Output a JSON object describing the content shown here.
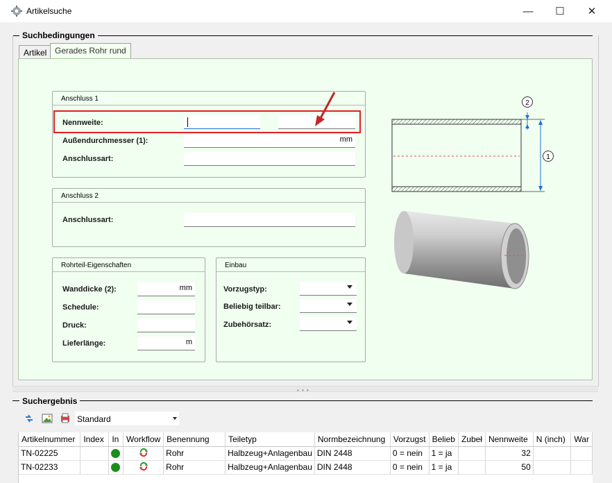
{
  "window": {
    "title": "Artikelsuche",
    "minimize": "—",
    "maximize": "☐",
    "close": "✕"
  },
  "search": {
    "group_title": "Suchbedingungen",
    "tabs": [
      {
        "label": "Artikel"
      },
      {
        "label": "Gerades Rohr rund"
      }
    ],
    "anschluss1": {
      "title": "Anschluss 1",
      "nennweite_label": "Nennweite:",
      "nennweite_value": "",
      "nennweite_value2": "",
      "aussen_label": "Außendurchmesser (1):",
      "aussen_unit": "mm",
      "anschlussart_label": "Anschlussart:",
      "anschlussart_value": ""
    },
    "anschluss2": {
      "title": "Anschluss 2",
      "anschlussart_label": "Anschlussart:",
      "anschlussart_value": ""
    },
    "rohrteil": {
      "title": "Rohrteil-Eigenschaften",
      "wanddicke_label": "Wanddicke (2):",
      "wanddicke_unit": "mm",
      "schedule_label": "Schedule:",
      "druck_label": "Druck:",
      "lieferlaenge_label": "Lieferlänge:",
      "lieferlaenge_unit": "m"
    },
    "einbau": {
      "title": "Einbau",
      "vorzugstyp_label": "Vorzugstyp:",
      "teilbar_label": "Beliebig teilbar:",
      "zubehoer_label": "Zubehörsatz:"
    },
    "diagram": {
      "dim1": "1",
      "dim2": "2"
    }
  },
  "results": {
    "group_title": "Suchergebnis",
    "view_select": "Standard",
    "columns": [
      "Artikelnummer",
      "Index",
      "In",
      "Workflow",
      "Benennung",
      "Teiletyp",
      "Normbezeichnung",
      "Vorzugst",
      "Belieb",
      "Zubeł",
      "Nennweite",
      "N (inch)",
      "War"
    ],
    "rows": [
      {
        "artikelnummer": "TN-02225",
        "index": "",
        "benennung": "Rohr",
        "teiletyp": "Halbzeug+Anlagenbau",
        "norm": "DIN 2448",
        "vorzug": "0 = nein",
        "beliebig": "1 = ja",
        "zubeh": "",
        "nennweite": "32",
        "ninch": "",
        "war": ""
      },
      {
        "artikelnummer": "TN-02233",
        "index": "",
        "benennung": "Rohr",
        "teiletyp": "Halbzeug+Anlagenbau",
        "norm": "DIN 2448",
        "vorzug": "0 = nein",
        "beliebig": "1 = ja",
        "zubeh": "",
        "nennweite": "50",
        "ninch": "",
        "war": ""
      }
    ]
  },
  "colors": {
    "panel_bg": "#f0fff0",
    "highlight": "#e02020",
    "status_green": "#1a8f1a"
  }
}
